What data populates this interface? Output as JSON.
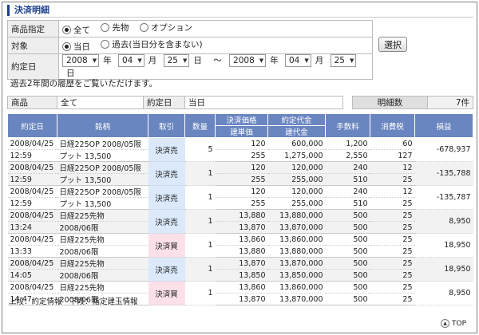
{
  "title": "決済明細",
  "filter": {
    "product_label": "商品指定",
    "product_options": [
      {
        "label": "全て",
        "checked": true
      },
      {
        "label": "先物",
        "checked": false
      },
      {
        "label": "オプション",
        "checked": false
      }
    ],
    "scope_label": "対象",
    "scope_options": [
      {
        "label": "当日",
        "checked": true
      },
      {
        "label": "過去(当日分を含まない)",
        "checked": false
      }
    ],
    "date_label": "約定日",
    "from": {
      "year": "2008",
      "month": "04",
      "day": "25"
    },
    "to": {
      "year": "2008",
      "month": "04",
      "day": "25"
    },
    "unit_year": "年",
    "unit_month": "月",
    "unit_day": "日",
    "separator": "～",
    "search_button": "選択"
  },
  "note": "過去2年間の履歴をご覧いただけます。",
  "summary": {
    "product_label": "商品",
    "product_value": "全て",
    "date_label": "約定日",
    "date_value": "当日",
    "count_label": "明細数",
    "count_value": "7件"
  },
  "columns": {
    "date": "約定日",
    "name": "銘柄",
    "trade": "取引",
    "qty": "数量",
    "price_top": "決済価格",
    "price_bottom": "建単価",
    "amount_top": "約定代金",
    "amount_bottom": "建代金",
    "fee": "手数料",
    "tax": "消費税",
    "pnl": "損益"
  },
  "rows": [
    {
      "date": "2008/04/25",
      "time": "12:59",
      "name1": "日経225OP 2008/05限",
      "name2": "プット 13,500",
      "trade": "決済売",
      "side": "sell",
      "qty": "5",
      "price": "120",
      "open_price": "255",
      "amount": "600,000",
      "open_amount": "1,275,000",
      "fee1": "1,200",
      "fee2": "2,550",
      "tax1": "60",
      "tax2": "127",
      "pnl": "-678,937"
    },
    {
      "date": "2008/04/25",
      "time": "12:59",
      "name1": "日経225OP 2008/05限",
      "name2": "プット 13,500",
      "trade": "決済売",
      "side": "sell",
      "qty": "1",
      "price": "120",
      "open_price": "255",
      "amount": "120,000",
      "open_amount": "255,000",
      "fee1": "240",
      "fee2": "510",
      "tax1": "12",
      "tax2": "25",
      "pnl": "-135,788"
    },
    {
      "date": "2008/04/25",
      "time": "12:59",
      "name1": "日経225OP 2008/05限",
      "name2": "プット 13,500",
      "trade": "決済売",
      "side": "sell",
      "qty": "1",
      "price": "120",
      "open_price": "255",
      "amount": "120,000",
      "open_amount": "255,000",
      "fee1": "240",
      "fee2": "510",
      "tax1": "12",
      "tax2": "25",
      "pnl": "-135,787"
    },
    {
      "date": "2008/04/25",
      "time": "13:24",
      "name1": "日経225先物",
      "name2": "2008/06限",
      "trade": "決済売",
      "side": "sell",
      "qty": "1",
      "price": "13,880",
      "open_price": "13,870",
      "amount": "13,880,000",
      "open_amount": "13,870,000",
      "fee1": "500",
      "fee2": "500",
      "tax1": "25",
      "tax2": "25",
      "pnl": "8,950"
    },
    {
      "date": "2008/04/25",
      "time": "13:33",
      "name1": "日経225先物",
      "name2": "2008/06限",
      "trade": "決済買",
      "side": "buy",
      "qty": "1",
      "price": "13,860",
      "open_price": "13,880",
      "amount": "13,860,000",
      "open_amount": "13,880,000",
      "fee1": "500",
      "fee2": "500",
      "tax1": "25",
      "tax2": "25",
      "pnl": "18,950"
    },
    {
      "date": "2008/04/25",
      "time": "14:05",
      "name1": "日経225先物",
      "name2": "2008/06限",
      "trade": "決済売",
      "side": "sell",
      "qty": "1",
      "price": "13,870",
      "open_price": "13,850",
      "amount": "13,870,000",
      "open_amount": "13,850,000",
      "fee1": "500",
      "fee2": "500",
      "tax1": "25",
      "tax2": "25",
      "pnl": "18,950"
    },
    {
      "date": "2008/04/25",
      "time": "14:47",
      "name1": "日経225先物",
      "name2": "2008/06限",
      "trade": "決済買",
      "side": "buy",
      "qty": "1",
      "price": "13,860",
      "open_price": "13,870",
      "amount": "13,860,000",
      "open_amount": "13,870,000",
      "fee1": "500",
      "fee2": "500",
      "tax1": "25",
      "tax2": "25",
      "pnl": "8,950"
    }
  ],
  "legend": "上段：約定情報　下段：指定建玉情報",
  "top_link": "TOP",
  "colors": {
    "header": "#6a86c0",
    "sell": "#dbe9fb",
    "buy": "#fbe0ea",
    "title": "#1c3f8f"
  }
}
